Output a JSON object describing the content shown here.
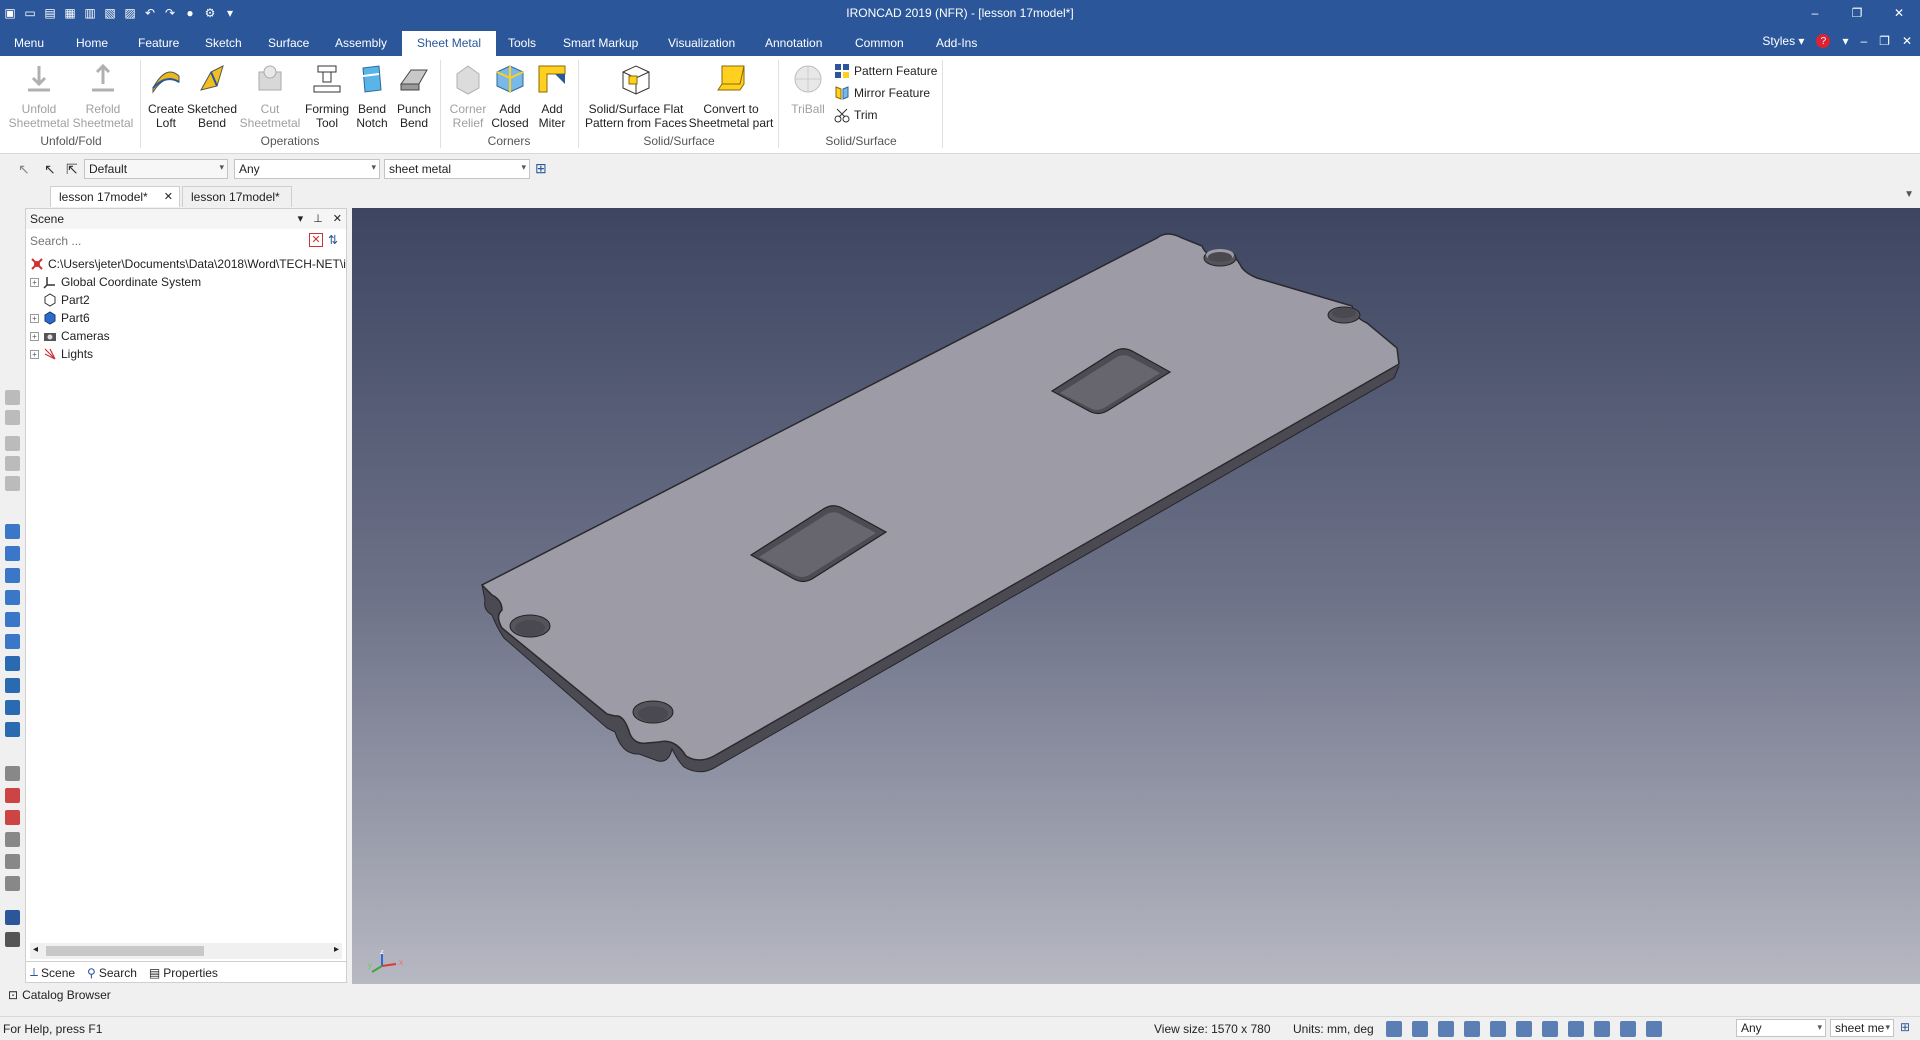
{
  "app": {
    "title": "IRONCAD 2019 (NFR) - [lesson 17model*]"
  },
  "window_controls": [
    "–",
    "❐",
    "✕"
  ],
  "ribbon_tabs": [
    "Menu",
    "Home",
    "Feature",
    "Sketch",
    "Surface",
    "Assembly",
    "Sheet Metal",
    "Tools",
    "Smart Markup",
    "Visualization",
    "Annotation",
    "Common",
    "Add-Ins"
  ],
  "active_tab": "Sheet Metal",
  "ribbon_right": {
    "styles": "Styles",
    "help_icon": "?",
    "min": "–",
    "restore": "❐",
    "close": "✕"
  },
  "ribbon": {
    "unfold": {
      "l1": "Unfold",
      "l2": "Sheetmetal"
    },
    "refold": {
      "l1": "Refold",
      "l2": "Sheetmetal"
    },
    "group_unfold": "Unfold/Fold",
    "create_loft": {
      "l1": "Create",
      "l2": "Loft"
    },
    "sketched_bend": {
      "l1": "Sketched",
      "l2": "Bend"
    },
    "cut_sheetmetal": {
      "l1": "Cut",
      "l2": "Sheetmetal"
    },
    "forming_tool": {
      "l1": "Forming",
      "l2": "Tool"
    },
    "bend_notch": {
      "l1": "Bend",
      "l2": "Notch"
    },
    "punch_bend": {
      "l1": "Punch",
      "l2": "Bend"
    },
    "group_operations": "Operations",
    "corner_relief": {
      "l1": "Corner",
      "l2": "Relief"
    },
    "add_closed": {
      "l1": "Add",
      "l2": "Closed"
    },
    "add_miter": {
      "l1": "Add",
      "l2": "Miter"
    },
    "group_corners": "Corners",
    "solid_flat": {
      "l1": "Solid/Surface Flat",
      "l2": "Pattern from Faces"
    },
    "convert": {
      "l1": "Convert to",
      "l2": "Sheetmetal part"
    },
    "group_solid1": "Solid/Surface",
    "triball": "TriBall",
    "pattern_feature": "Pattern Feature",
    "mirror_feature": "Mirror Feature",
    "trim": "Trim",
    "group_solid2": "Solid/Surface"
  },
  "toolbar": {
    "style_combo": "Default",
    "filter_combo": "Any",
    "type_combo": "sheet metal"
  },
  "doc_tabs": [
    {
      "label": "lesson 17model*",
      "close": "✕"
    },
    {
      "label": "lesson 17model*"
    }
  ],
  "scene": {
    "title": "Scene",
    "search_placeholder": "Search ...",
    "tree": [
      {
        "label": "C:\\Users\\jeter\\Documents\\Data\\2018\\Word\\TECH-NET\\i",
        "icon": "scene-root-icon"
      },
      {
        "label": "Global Coordinate System",
        "icon": "axis-icon"
      },
      {
        "label": "Part2",
        "icon": "part-outline-icon"
      },
      {
        "label": "Part6",
        "icon": "part-icon"
      },
      {
        "label": "Cameras",
        "icon": "camera-icon"
      },
      {
        "label": "Lights",
        "icon": "light-icon"
      }
    ],
    "bottom_tabs": [
      "Scene",
      "Search",
      "Properties"
    ]
  },
  "catalog": "Catalog Browser",
  "status": {
    "help": "For Help, press F1",
    "view_size": "View size: 1570 x  780",
    "units": "Units: mm, deg",
    "filter": "Any",
    "type": "sheet me"
  },
  "colors": {
    "titlebar": "#2b579a",
    "part_face": "#9d9ca6",
    "part_edge": "#2a2a2e"
  }
}
